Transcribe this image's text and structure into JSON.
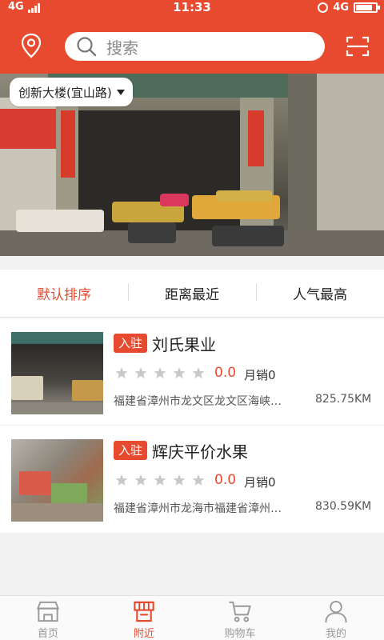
{
  "status_bar": {
    "network": "4G",
    "time": "11:33",
    "network_right": "4G",
    "battery_level": 0.85
  },
  "header": {
    "location_icon": "location-pin-icon",
    "search_placeholder": "搜索",
    "scan_icon": "scan-icon"
  },
  "banner": {
    "location_label": "创新大楼(宜山路)"
  },
  "sort_tabs": [
    {
      "label": "默认排序",
      "active": true
    },
    {
      "label": "距离最近",
      "active": false
    },
    {
      "label": "人气最高",
      "active": false
    }
  ],
  "stores": [
    {
      "badge": "入驻",
      "name": "刘氏果业",
      "stars": 5,
      "rating": "0.0",
      "sales": "月销0",
      "address": "福建省漳州市龙文区龙文区海峡…",
      "distance": "825.75KM"
    },
    {
      "badge": "入驻",
      "name": "辉庆平价水果",
      "stars": 5,
      "rating": "0.0",
      "sales": "月销0",
      "address": "福建省漳州市龙海市福建省漳州…",
      "distance": "830.59KM"
    }
  ],
  "bottom_nav": [
    {
      "label": "首页",
      "icon": "store-icon",
      "active": false
    },
    {
      "label": "附近",
      "icon": "nearby-icon",
      "active": true
    },
    {
      "label": "购物车",
      "icon": "cart-icon",
      "active": false
    },
    {
      "label": "我的",
      "icon": "user-icon",
      "active": false
    }
  ],
  "colors": {
    "accent": "#e84a2f",
    "star_inactive": "#c8c8c8",
    "nav_inactive": "#999999"
  }
}
